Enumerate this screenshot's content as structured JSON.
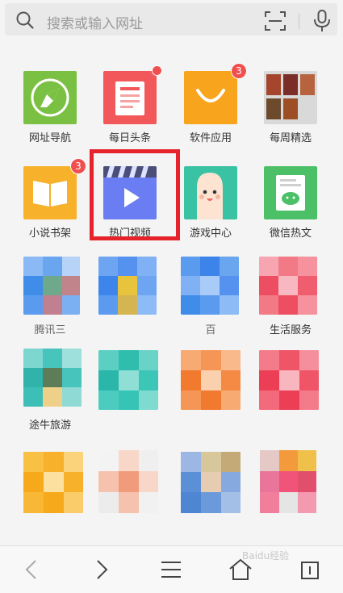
{
  "search": {
    "placeholder": "搜索或输入网址"
  },
  "apps": [
    {
      "label": "网址导航",
      "icon": "compass-icon"
    },
    {
      "label": "每日头条",
      "icon": "news-icon"
    },
    {
      "label": "软件应用",
      "icon": "shopping-bag-icon"
    },
    {
      "label": "每周精选",
      "icon": "game-grid-icon"
    },
    {
      "label": "小说书架",
      "icon": "book-icon"
    },
    {
      "label": "热门视频",
      "icon": "clapperboard-icon"
    },
    {
      "label": "游戏中心",
      "icon": "finger-character-icon"
    },
    {
      "label": "微信热文",
      "icon": "wechat-article-icon"
    },
    {
      "label": "腾讯三",
      "icon": "blurred-tile"
    },
    {
      "label": "",
      "icon": "blurred-tile"
    },
    {
      "label": "百",
      "icon": "blurred-tile"
    },
    {
      "label": "生活服务",
      "icon": "blurred-tile"
    },
    {
      "label": "途牛旅游",
      "icon": "blurred-tile"
    },
    {
      "label": "",
      "icon": "blurred-tile"
    },
    {
      "label": "",
      "icon": "blurred-tile"
    },
    {
      "label": "",
      "icon": "blurred-tile"
    }
  ],
  "badges": {
    "software": "3",
    "novel": "3"
  },
  "watermark": "Baidu经验",
  "colors": {
    "highlight": "#e6232a",
    "badge": "#f04f4f"
  }
}
